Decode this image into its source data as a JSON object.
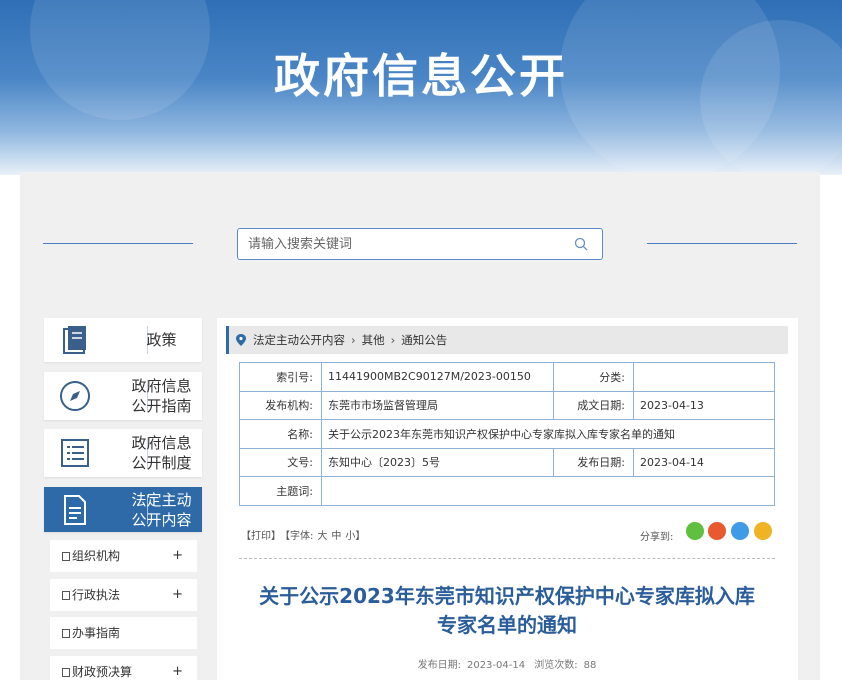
{
  "banner": {
    "title": "政府信息公开"
  },
  "search": {
    "placeholder": "请输入搜索关键词"
  },
  "sidebar": {
    "cards": [
      {
        "label": "政策"
      },
      {
        "label": "政府信息\n公开指南"
      },
      {
        "label": "政府信息\n公开制度"
      },
      {
        "label": "法定主动\n公开内容"
      }
    ],
    "sub_items": [
      {
        "label": "组织机构",
        "expander": "+"
      },
      {
        "label": "行政执法",
        "expander": "+"
      },
      {
        "label": "办事指南",
        "expander": ""
      },
      {
        "label": "财政预决算",
        "expander": "+"
      }
    ]
  },
  "breadcrumb": {
    "items": [
      "法定主动公开内容",
      "其他",
      "通知公告"
    ],
    "separator": "›"
  },
  "meta": {
    "index_no_label": "索引号:",
    "index_no": "11441900MB2C90127M/2023-00150",
    "category_label": "分类:",
    "category": "",
    "issuer_label": "发布机构:",
    "issuer": "东莞市市场监督管理局",
    "created_label": "成文日期:",
    "created": "2023-04-13",
    "name_label": "名称:",
    "name": "关于公示2023年东莞市知识产权保护中心专家库拟入库专家名单的通知",
    "doc_no_label": "文号:",
    "doc_no": "东知中心〔2023〕5号",
    "published_label": "发布日期:",
    "published": "2023-04-14",
    "topic_label": "主题词:",
    "topic": ""
  },
  "tools": {
    "print": "【打印】",
    "font_label": "【字体:",
    "font_large": "大",
    "font_medium": "中",
    "font_small": "小】",
    "share_label": "分享到:"
  },
  "article": {
    "title_line1": "关于公示2023年东莞市知识产权保护中心专家库拟入库",
    "title_line2": "专家名单的通知",
    "date_label": "发布日期:",
    "date": "2023-04-14",
    "views_label": "浏览次数:",
    "views": "88"
  },
  "colors": {
    "accent": "#2e6aa8",
    "title": "#2a5d9a"
  }
}
